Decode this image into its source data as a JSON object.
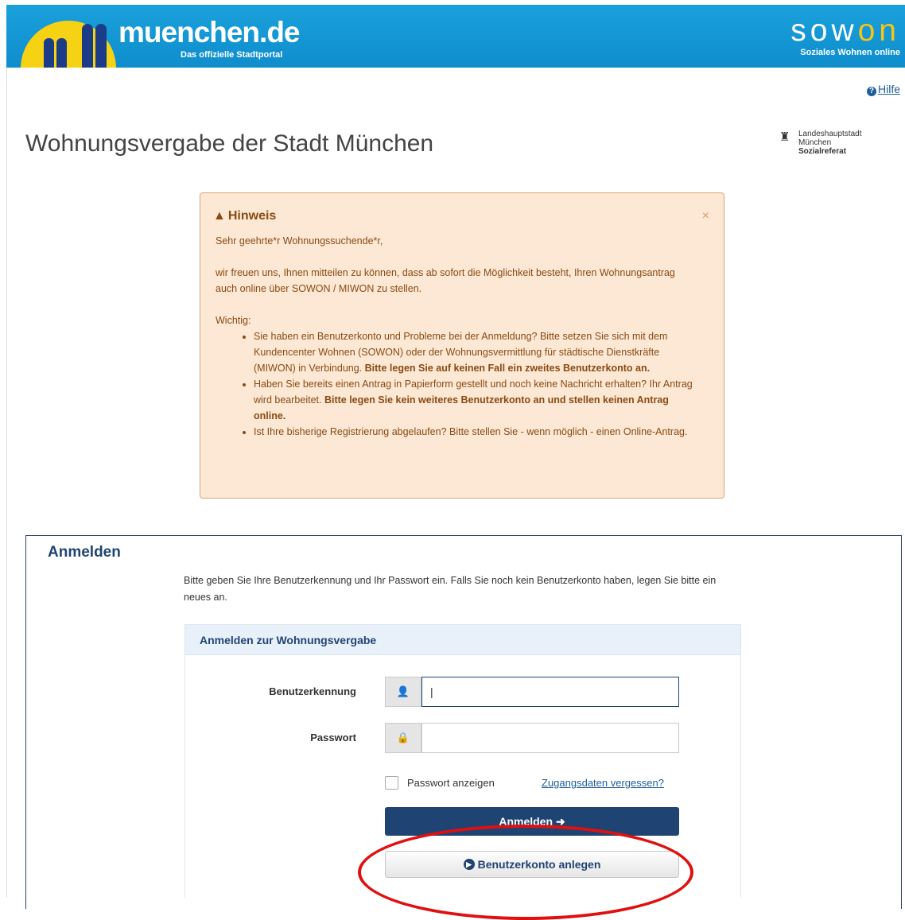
{
  "header": {
    "brand": "muenchen.de",
    "brand_sub": "Das offizielle Stadtportal",
    "sowon_a": "sow",
    "sowon_b": "on",
    "sowon_sub": "Soziales Wohnen online",
    "colors": {
      "bar": "#1aa1dc",
      "sun": "#f5d314",
      "tower": "#1d3c88"
    }
  },
  "help": {
    "label": "Hilfe"
  },
  "page": {
    "title": "Wohnungsvergabe der Stadt München"
  },
  "municipal": {
    "line1": "Landeshauptstadt",
    "line2": "München",
    "line3": "Sozialreferat"
  },
  "notice": {
    "heading": "Hinweis",
    "close": "×",
    "greeting": "Sehr geehrte*r Wohnungssuchende*r,",
    "paragraph": "wir freuen uns, Ihnen mitteilen zu können, dass ab sofort die Möglichkeit besteht, Ihren Wohnungsantrag auch online über SOWON / MIWON zu stellen.",
    "important": "Wichtig:",
    "bullets": [
      {
        "text": "Sie haben ein Benutzerkonto und Probleme bei der Anmeldung? Bitte setzen Sie sich mit dem Kundencenter Wohnen (SOWON) oder der Wohnungsvermittlung für städtische Dienstkräfte (MIWON) in Verbindung. ",
        "bold": "Bitte legen Sie auf keinen Fall ein zweites Benutzerkonto an."
      },
      {
        "text": "Haben Sie bereits einen Antrag in Papierform gestellt und noch keine Nachricht erhalten? Ihr Antrag wird bearbeitet. ",
        "bold": "Bitte legen Sie kein weiteres Benutzerkonto an und stellen keinen Antrag online."
      },
      {
        "text": "Ist Ihre bisherige Registrierung abgelaufen? Bitte stellen Sie - wenn möglich - einen Online-Antrag.",
        "bold": ""
      }
    ]
  },
  "login": {
    "title": "Anmelden",
    "intro": "Bitte geben Sie Ihre Benutzerkennung und Ihr Passwort ein. Falls Sie noch kein Benutzerkonto haben, legen Sie bitte ein neues an.",
    "panel_title": "Anmelden zur Wohnungsvergabe",
    "username_label": "Benutzerkennung",
    "username_value": "|",
    "password_label": "Passwort",
    "password_value": "",
    "show_password_label": "Passwort anzeigen",
    "show_password_checked": false,
    "forgot_label": "Zugangsdaten vergessen?",
    "submit_label": "Anmelden",
    "register_label": "Benutzerkonto anlegen",
    "highlight_color": "#e01010"
  }
}
